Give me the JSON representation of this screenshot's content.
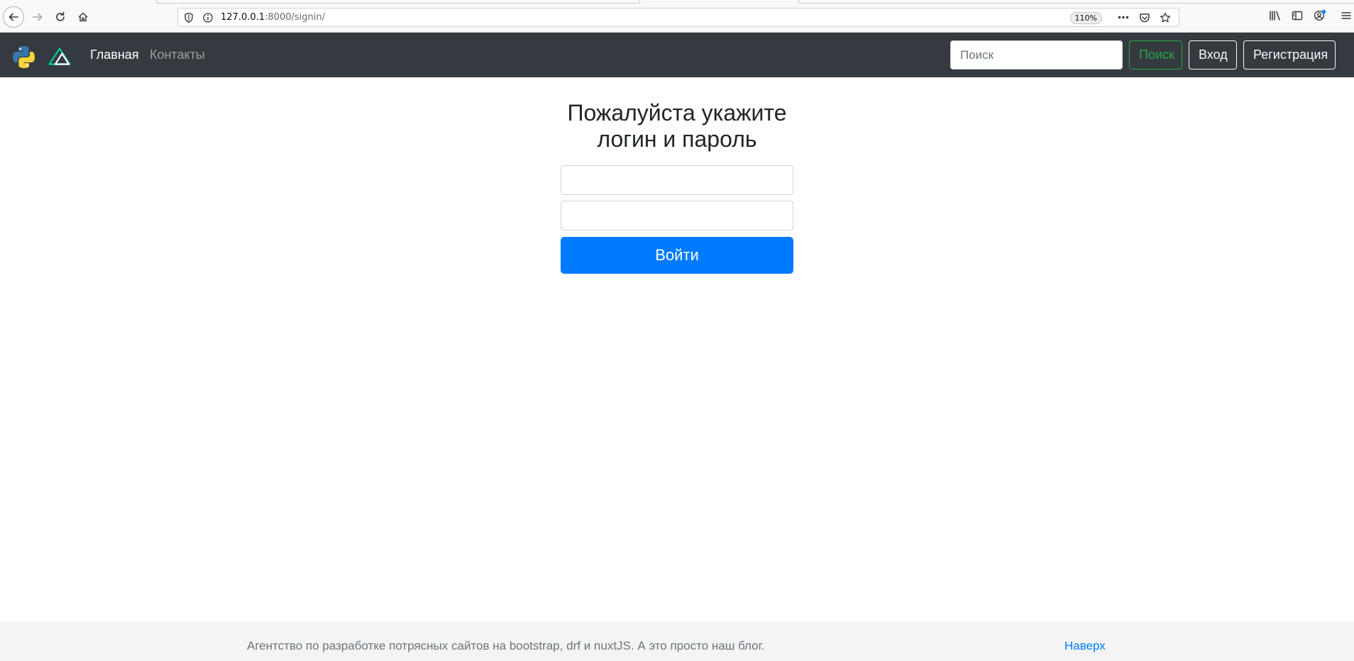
{
  "browser": {
    "url_host": "127.0.0.1",
    "url_rest": ":8000/signin/",
    "zoom": "110%"
  },
  "navbar": {
    "links": [
      {
        "label": "Главная"
      },
      {
        "label": "Контакты"
      }
    ],
    "search_placeholder": "Поиск",
    "search_button": "Поиск",
    "login_button": "Вход",
    "register_button": "Регистрация"
  },
  "signin": {
    "heading_line1": "Пожалуйста укажите",
    "heading_line2": "логин и пароль",
    "submit_label": "Войти"
  },
  "footer": {
    "text": "Агентство по разработке потрясных сайтов на bootstrap, drf и nuxtJS. А это просто наш блог.",
    "top_link": "Наверх"
  },
  "colors": {
    "navbar_bg": "#343a40",
    "primary": "#007bff",
    "success": "#28a745",
    "footer_bg": "#f4f4f4"
  }
}
